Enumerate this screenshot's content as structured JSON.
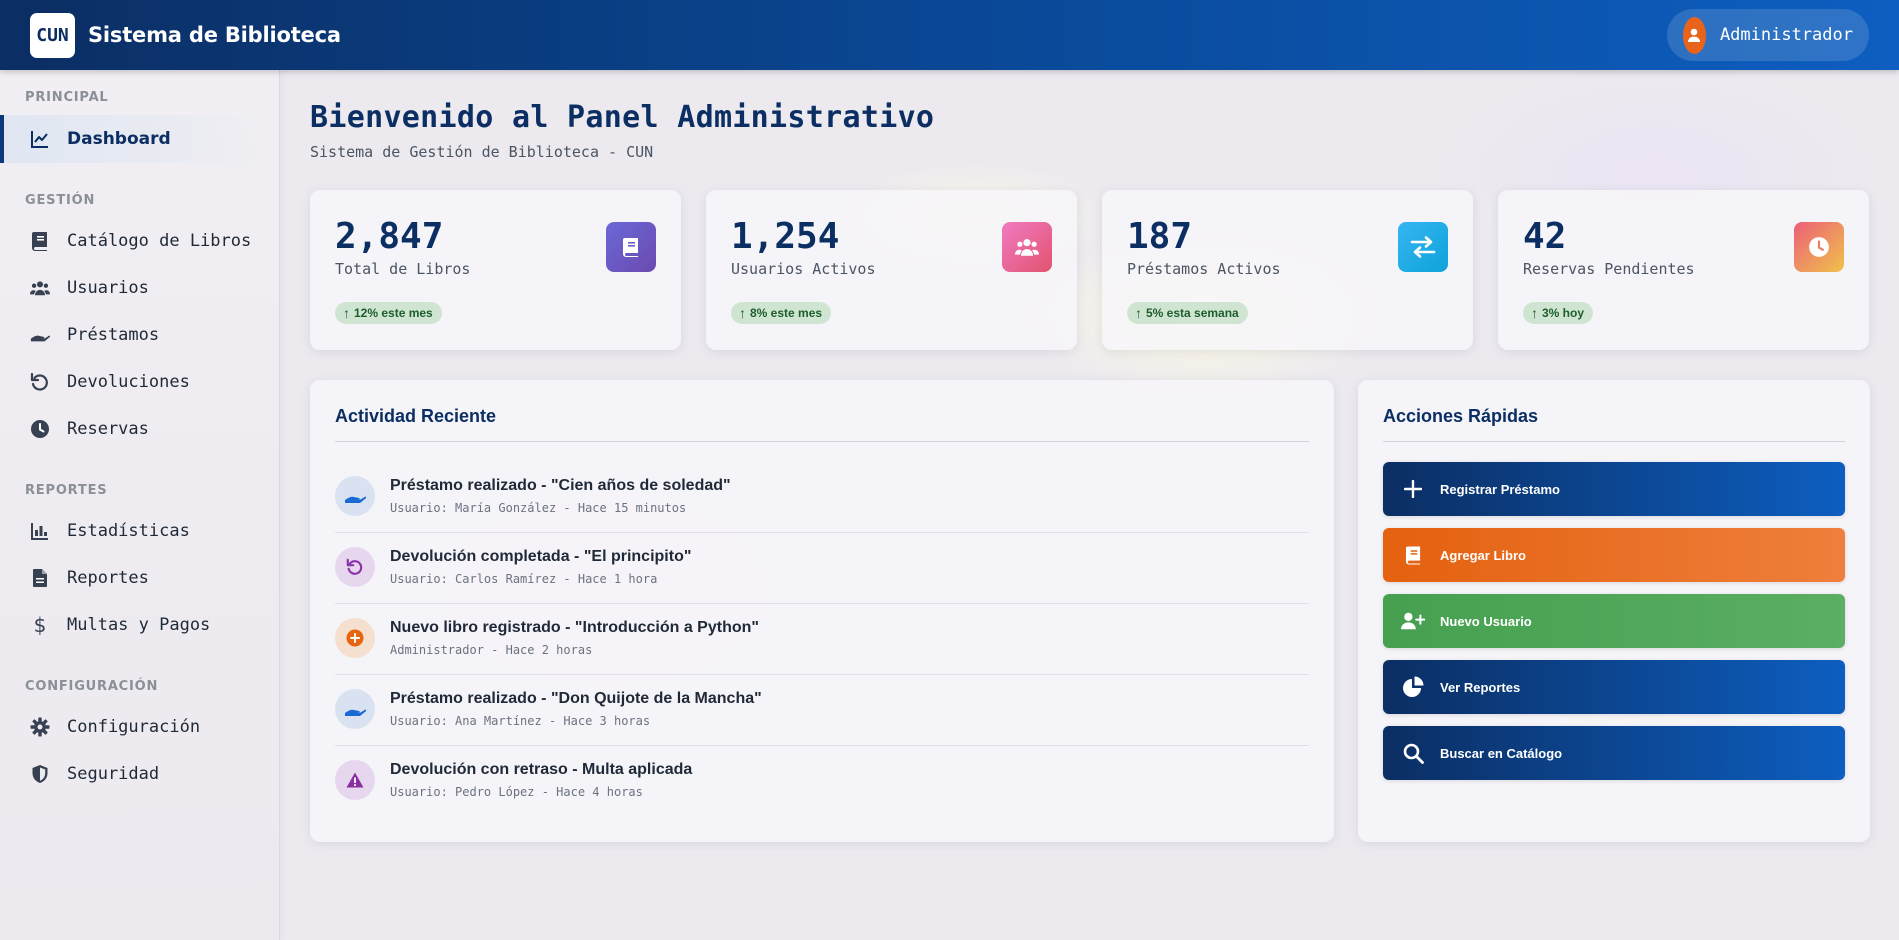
{
  "header": {
    "logo_text": "CUN",
    "app_title": "Sistema de Biblioteca",
    "user_name": "Administrador"
  },
  "sidebar": {
    "sections": [
      {
        "title": "PRINCIPAL",
        "items": [
          {
            "label": "Dashboard",
            "icon": "chart-line-icon",
            "active": true
          }
        ]
      },
      {
        "title": "GESTIÓN",
        "items": [
          {
            "label": "Catálogo de Libros",
            "icon": "book-icon"
          },
          {
            "label": "Usuarios",
            "icon": "users-icon"
          },
          {
            "label": "Préstamos",
            "icon": "hand-holding-icon"
          },
          {
            "label": "Devoluciones",
            "icon": "undo-icon"
          },
          {
            "label": "Reservas",
            "icon": "clock-icon"
          }
        ]
      },
      {
        "title": "REPORTES",
        "items": [
          {
            "label": "Estadísticas",
            "icon": "bar-chart-icon"
          },
          {
            "label": "Reportes",
            "icon": "file-icon"
          },
          {
            "label": "Multas y Pagos",
            "icon": "dollar-icon"
          }
        ]
      },
      {
        "title": "CONFIGURACIÓN",
        "items": [
          {
            "label": "Configuración",
            "icon": "gear-icon"
          },
          {
            "label": "Seguridad",
            "icon": "shield-icon"
          }
        ]
      }
    ]
  },
  "main": {
    "title": "Bienvenido al Panel Administrativo",
    "subtitle": "Sistema de Gestión de Biblioteca - CUN",
    "stats": [
      {
        "value": "2,847",
        "label": "Total de Libros",
        "trend": "12% este mes",
        "icon": "book-icon",
        "color": "#6a5acd"
      },
      {
        "value": "1,254",
        "label": "Usuarios Activos",
        "trend": "8% este mes",
        "icon": "users-icon",
        "color": "#e8579a"
      },
      {
        "value": "187",
        "label": "Préstamos Activos",
        "trend": "5% esta semana",
        "icon": "exchange-icon",
        "color": "#19a9e6"
      },
      {
        "value": "42",
        "label": "Reservas Pendientes",
        "trend": "3% hoy",
        "icon": "clock-icon",
        "color": "#ec6f6a"
      }
    ],
    "activity": {
      "title": "Actividad Reciente",
      "items": [
        {
          "title": "Préstamo realizado - \"Cien años de soledad\"",
          "meta": "Usuario: María González - Hace 15 minutos",
          "icon": "hand-holding-icon"
        },
        {
          "title": "Devolución completada - \"El principito\"",
          "meta": "Usuario: Carlos Ramírez - Hace 1 hora",
          "icon": "undo-icon"
        },
        {
          "title": "Nuevo libro registrado - \"Introducción a Python\"",
          "meta": "Administrador - Hace 2 horas",
          "icon": "plus-circle-icon"
        },
        {
          "title": "Préstamo realizado - \"Don Quijote de la Mancha\"",
          "meta": "Usuario: Ana Martínez - Hace 3 horas",
          "icon": "hand-holding-icon"
        },
        {
          "title": "Devolución con retraso - Multa aplicada",
          "meta": "Usuario: Pedro López - Hace 4 horas",
          "icon": "warning-icon"
        }
      ]
    },
    "quick_actions": {
      "title": "Acciones Rápidas",
      "buttons": [
        {
          "label": "Registrar Préstamo",
          "icon": "plus-icon",
          "color": "#0b2e63"
        },
        {
          "label": "Agregar Libro",
          "icon": "book-icon",
          "color": "#e4610f"
        },
        {
          "label": "Nuevo Usuario",
          "icon": "user-plus-icon",
          "color": "#46a050"
        },
        {
          "label": "Ver Reportes",
          "icon": "pie-chart-icon",
          "color": "#0b2e63"
        },
        {
          "label": "Buscar en Catálogo",
          "icon": "search-icon",
          "color": "#0b2e63"
        }
      ]
    }
  }
}
